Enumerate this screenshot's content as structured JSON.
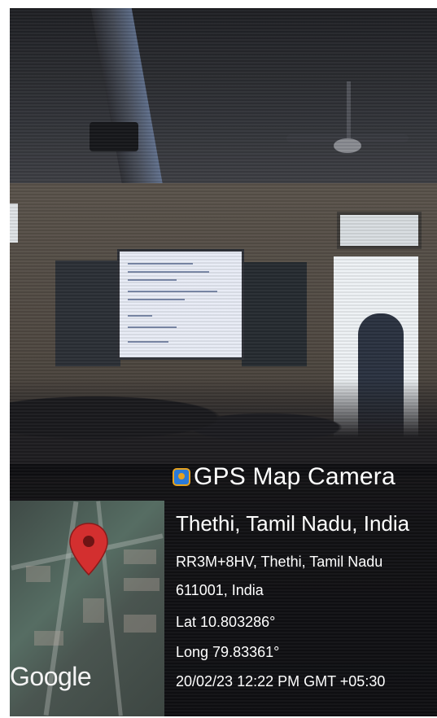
{
  "brand": {
    "app_name": "GPS Map Camera",
    "icon": "gps-map-camera-icon"
  },
  "map": {
    "attribution": "Google",
    "marker_icon": "map-pin-icon",
    "marker_color": "#d32f2f"
  },
  "location": {
    "title": "Thethi, Tamil Nadu, India",
    "address_line1": "RR3M+8HV, Thethi, Tamil Nadu",
    "address_line2": "611001, India",
    "latitude": "Lat 10.803286°",
    "longitude": "Long 79.83361°",
    "timestamp": "20/02/23 12:22 PM GMT +05:30"
  }
}
